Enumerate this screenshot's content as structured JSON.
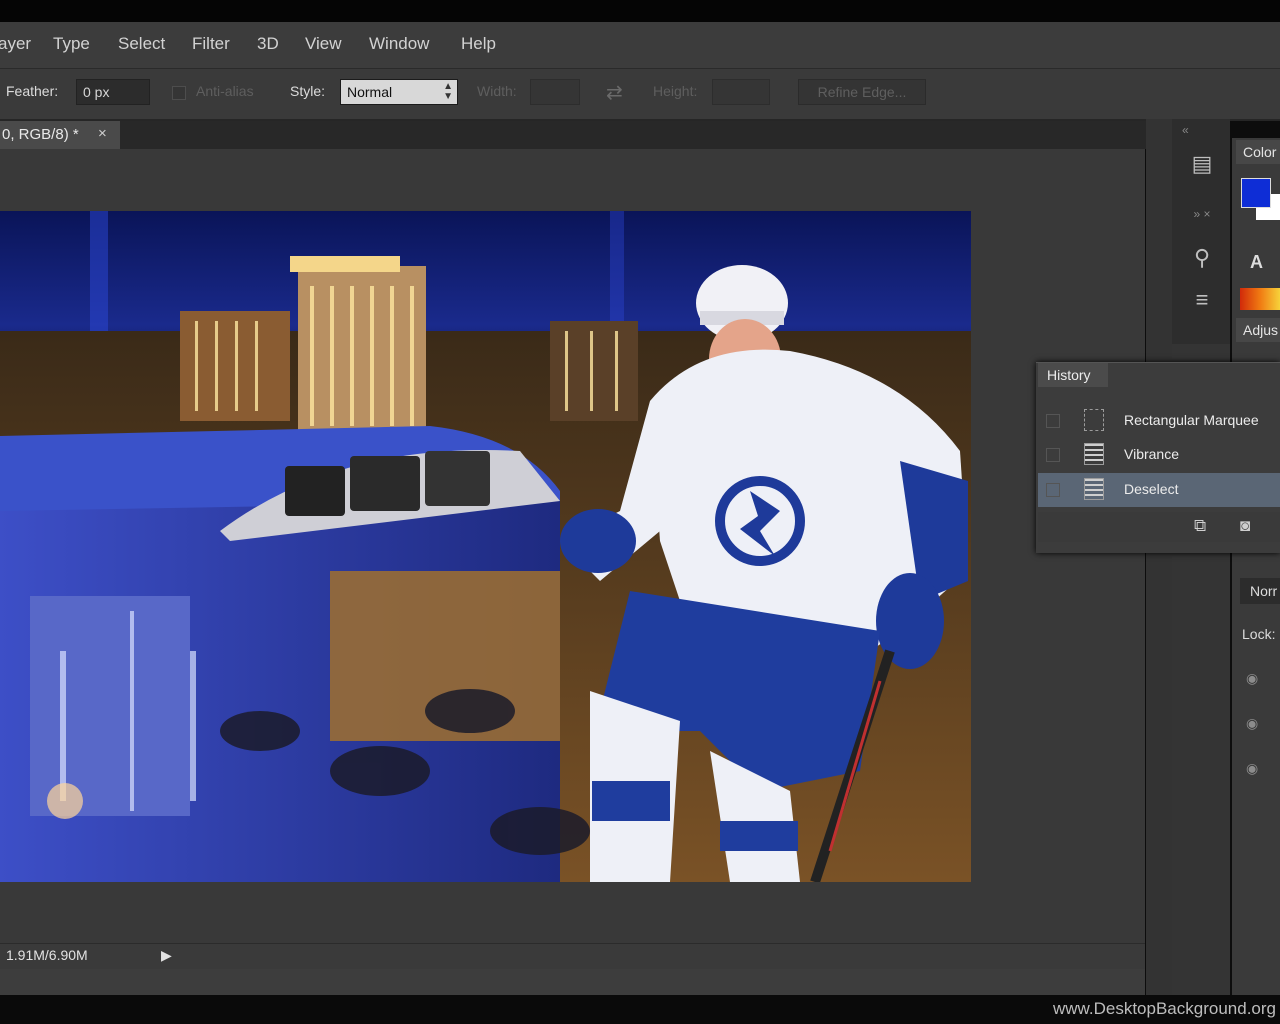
{
  "menu": {
    "items": [
      "ayer",
      "Type",
      "Select",
      "Filter",
      "3D",
      "View",
      "Window",
      "Help"
    ]
  },
  "options": {
    "feather_label": "Feather:",
    "feather_value": "0 px",
    "antialias_label": "Anti-alias",
    "style_label": "Style:",
    "style_value": "Normal",
    "width_label": "Width:",
    "height_label": "Height:",
    "refine_edge_label": "Refine Edge..."
  },
  "document": {
    "tab_title": "0, RGB/8) *",
    "close_glyph": "×"
  },
  "status": {
    "doc_size": "1.91M/6.90M",
    "arrow_glyph": "▶"
  },
  "panels": {
    "color_tab": "Color",
    "adjustments_tab": "Adjus",
    "history_tab": "History",
    "history_items": [
      "Rectangular Marquee",
      "Vibrance",
      "Deselect"
    ],
    "layers_blend": "Norr",
    "lock_label": "Lock:"
  },
  "colors": {
    "foreground": "#0e2dd6",
    "background": "#ffffff",
    "ui_dark": "#3c3c3c"
  },
  "icons": [
    "close-icon",
    "arrow-right-icon",
    "new-snapshot-icon",
    "camera-icon",
    "eye-icon",
    "swap-icon",
    "collapse-icon"
  ],
  "watermark": "www.DesktopBackground.org"
}
